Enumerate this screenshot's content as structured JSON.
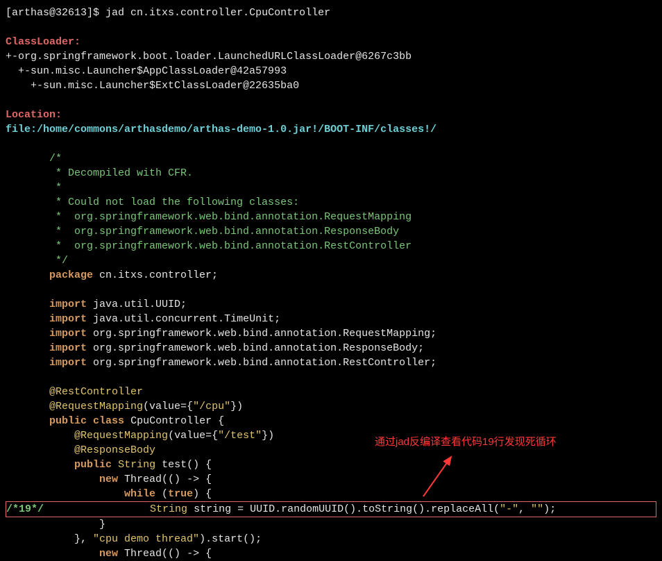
{
  "prompt": {
    "user": "[arthas@32613]$",
    "command": " jad cn.itxs.controller.CpuController"
  },
  "classloader": {
    "heading": "ClassLoader:",
    "line1": "+-org.springframework.boot.loader.LaunchedURLClassLoader@6267c3bb",
    "line2": "  +-sun.misc.Launcher$AppClassLoader@42a57993",
    "line3": "    +-sun.misc.Launcher$ExtClassLoader@22635ba0"
  },
  "location": {
    "heading": "Location:",
    "path": "file:/home/commons/arthasdemo/arthas-demo-1.0.jar!/BOOT-INF/classes!/"
  },
  "code": {
    "c1": "       /*",
    "c2": "        * Decompiled with CFR.",
    "c3": "        *",
    "c4": "        * Could not load the following classes:",
    "c5": "        *  org.springframework.web.bind.annotation.RequestMapping",
    "c6": "        *  org.springframework.web.bind.annotation.ResponseBody",
    "c7": "        *  org.springframework.web.bind.annotation.RestController",
    "c8": "        */",
    "pkg_kw": "package",
    "pkg_name": " cn.itxs.controller;",
    "import_kw": "import",
    "imp1": " java.util.UUID;",
    "imp2": " java.util.concurrent.TimeUnit;",
    "imp3": " org.springframework.web.bind.annotation.RequestMapping;",
    "imp4": " org.springframework.web.bind.annotation.ResponseBody;",
    "imp5": " org.springframework.web.bind.annotation.RestController;",
    "ann_rest": "@RestController",
    "ann_req": "@RequestMapping",
    "ann_req_val": "(value={",
    "ann_req_str": "\"/cpu\"",
    "ann_close": "})",
    "public_kw": "public",
    "class_kw": "class",
    "class_name": " CpuController {",
    "req_test": "\"/test\"",
    "ann_body": "@ResponseBody",
    "string_type": "String",
    "method_name": " test() {",
    "new_kw": "new",
    "thread_call": " Thread(() -> {",
    "while_kw": "while",
    "true_kw": "true",
    "while_open": " (",
    "while_close": ") {",
    "line19_marker": "/*19*/",
    "line19_pad": "                 ",
    "string_kw": "String",
    "line19_var": " string = UUID.randomUUID().toString().replaceAll(",
    "line19_arg1": "\"-\"",
    "line19_comma": ", ",
    "line19_arg2": "\"\"",
    "line19_end": ");",
    "close_brace": "               }",
    "thread_name": "\"cpu demo thread\"",
    "thread_close1": "           }, ",
    "thread_close2": ").start();",
    "new_thread2": " Thread(() -> {"
  },
  "annotation": {
    "text": "通过jad反编译查看代码19行发现死循环"
  }
}
